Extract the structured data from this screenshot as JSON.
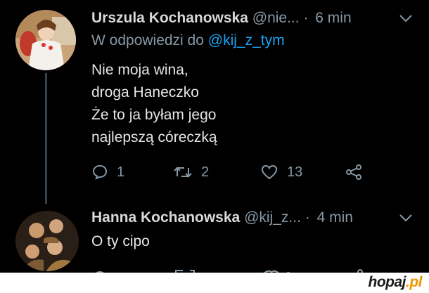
{
  "tweets": [
    {
      "name": "Urszula Kochanowska",
      "handle": "@nie...",
      "dot": "·",
      "time": "6 min",
      "reply_prefix": "W odpowiedzi do",
      "reply_mention": "@kij_z_tym",
      "lines": [
        "Nie moja wina,",
        "droga Haneczko",
        "Że to ja byłam jego",
        "najlepszą córeczką"
      ],
      "reply_count": "1",
      "retweet_count": "2",
      "like_count": "13"
    },
    {
      "name": "Hanna Kochanowska",
      "handle": "@kij_z...",
      "dot": "·",
      "time": "4 min",
      "lines": [
        "O ty cipo"
      ]
    }
  ],
  "icons": {
    "reply": "speech-bubble",
    "retweet": "retweet-arrows",
    "like": "heart",
    "share": "share-nodes",
    "menu": "chevron-down"
  },
  "colors": {
    "background": "#000000",
    "link": "#1da1f2",
    "muted": "#8899a6",
    "watermark_accent": "#f29400"
  },
  "watermark": {
    "brand": "hopaj",
    "tld": ".pl"
  }
}
